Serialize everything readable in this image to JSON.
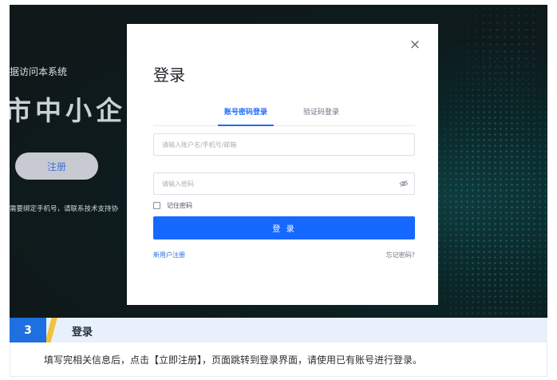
{
  "background": {
    "subtitle": "据访问本系统",
    "headline": "市中小企业",
    "register_button": "注册",
    "note": "需要绑定手机号，请联系技术支持协"
  },
  "login_modal": {
    "title": "登录",
    "close_icon": "close-icon",
    "tabs": [
      {
        "label": "账号密码登录",
        "active": true
      },
      {
        "label": "验证码登录",
        "active": false
      }
    ],
    "account_placeholder": "请输入账户名/手机号/邮箱",
    "password_placeholder": "请输入密码",
    "remember_label": "记住密码",
    "login_button": "登 录",
    "new_user_link": "新用户注册",
    "forgot_link": "忘记密码?"
  },
  "step": {
    "number": "3",
    "title": "登录",
    "description": "填写完相关信息后，点击【立即注册】，页面跳转到登录界面，请使用已有账号进行登录。"
  },
  "colors": {
    "accent": "#1668ff",
    "step_badge": "#1e6fe0",
    "step_slash": "#f0c33a"
  }
}
